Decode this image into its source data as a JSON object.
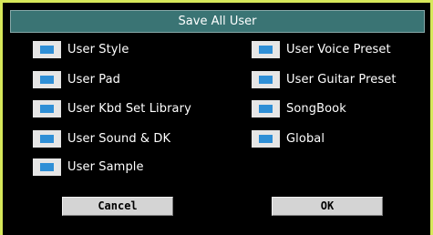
{
  "dialog": {
    "title": "Save All User",
    "options_left": [
      {
        "label": "User Style",
        "checked": true
      },
      {
        "label": "User Pad",
        "checked": true
      },
      {
        "label": "User Kbd Set Library",
        "checked": true
      },
      {
        "label": "User Sound & DK",
        "checked": true
      },
      {
        "label": "User Sample",
        "checked": true
      }
    ],
    "options_right": [
      {
        "label": "User Voice Preset",
        "checked": true
      },
      {
        "label": "User Guitar Preset",
        "checked": true
      },
      {
        "label": "SongBook",
        "checked": true
      },
      {
        "label": "Global",
        "checked": true
      }
    ],
    "cancel_label": "Cancel",
    "ok_label": "OK"
  },
  "colors": {
    "title_bar": "#3a7474",
    "checkbox_mark": "#2f8fd6",
    "background": "#000000",
    "outer_frame": "#d7e85a"
  }
}
